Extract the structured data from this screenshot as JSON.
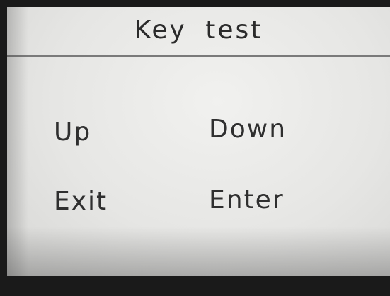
{
  "screen": {
    "title": "Key test",
    "keys": [
      {
        "label": "Up"
      },
      {
        "label": "Down"
      },
      {
        "label": "Exit"
      },
      {
        "label": "Enter"
      }
    ]
  },
  "colors": {
    "screen_background": "#e8e8e6",
    "text": "#2b2b2b",
    "divider": "#7a7a7a",
    "bezel": "#1a1a1a"
  }
}
